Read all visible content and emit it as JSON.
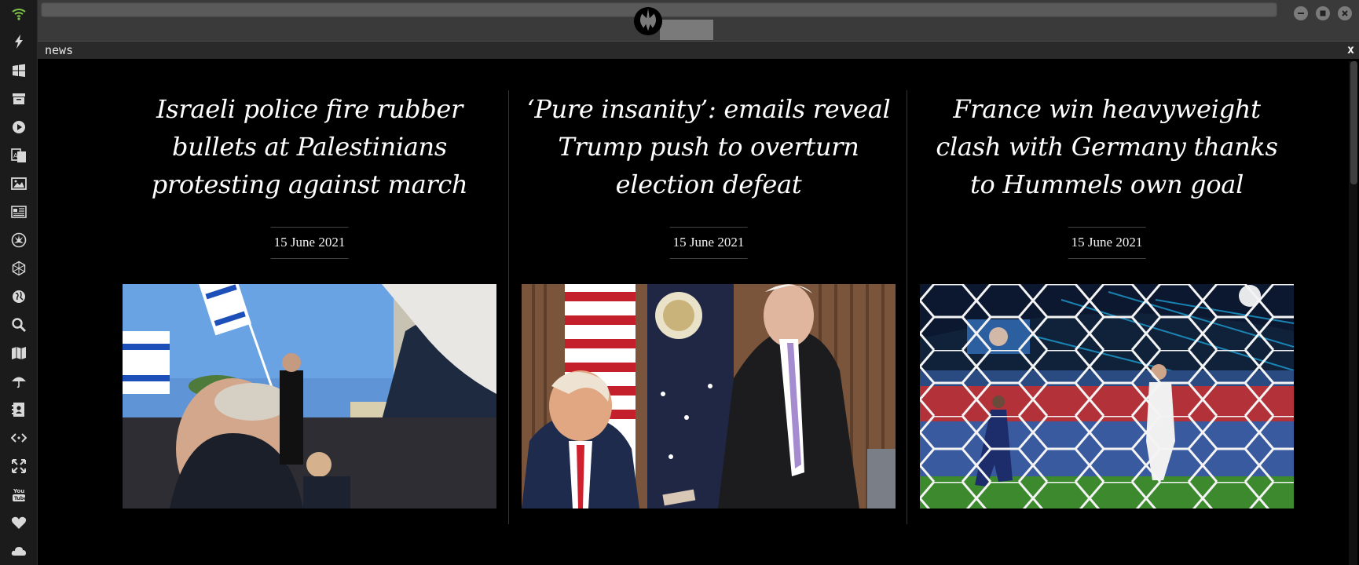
{
  "dock": {
    "icons": [
      "wifi-icon",
      "lightning-icon",
      "windows-icon",
      "archive-icon",
      "play-icon",
      "translate-icon",
      "image-icon",
      "newspaper-icon",
      "rebel-alliance-icon",
      "hexagon-network-icon",
      "globe-icon",
      "search-icon",
      "map-icon",
      "umbrella-icon",
      "contacts-icon",
      "code-link-icon",
      "expand-icon",
      "youtube-icon",
      "heart-icon",
      "cloud-icon"
    ],
    "accent": "#7ec44a"
  },
  "window": {
    "logo_icon": "rebel-alliance-emblem-icon",
    "buttons": [
      "minimize-icon",
      "maximize-icon",
      "close-icon"
    ]
  },
  "tab": {
    "title": "news",
    "close_label": "x"
  },
  "articles": [
    {
      "title": "Israeli police fire rubber bullets at Palestinians protesting against march",
      "date": "15 June 2021",
      "image": "protest-with-israeli-flags-photo"
    },
    {
      "title": "‘Pure insanity’: emails reveal Trump push to overturn election defeat",
      "date": "15 June 2021",
      "image": "trump-in-oval-office-photo"
    },
    {
      "title": "France win heavyweight clash with Germany thanks to Hummels own goal",
      "date": "15 June 2021",
      "image": "football-goal-net-stadium-photo"
    }
  ]
}
